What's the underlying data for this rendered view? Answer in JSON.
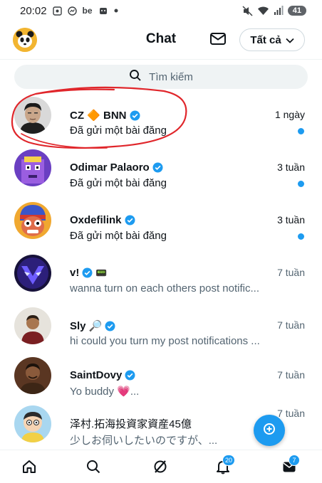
{
  "status_bar": {
    "time": "20:02",
    "icons": [
      "screenshot-icon",
      "messenger-icon",
      "be-app-icon",
      "app-icon",
      "dot-icon"
    ],
    "be_label": "be",
    "right_icons": [
      "mute-icon",
      "wifi-icon",
      "signal-icon"
    ],
    "battery": "41"
  },
  "header": {
    "title": "Chat",
    "filter_label": "Tất cả"
  },
  "search": {
    "placeholder": "Tìm kiếm"
  },
  "chats": [
    {
      "name": "CZ 🔶 BNN",
      "verified": true,
      "time": "1 ngày",
      "message": "Đã gửi một bài đăng",
      "unread": true,
      "avatar": "cz-avatar"
    },
    {
      "name": "Odimar Palaoro",
      "verified": true,
      "time": "3 tuần",
      "message": "Đã gửi một bài đăng",
      "unread": true,
      "avatar": "odimar-avatar"
    },
    {
      "name": "Oxdefilink",
      "verified": true,
      "time": "3 tuần",
      "message": "Đã gửi một bài đăng",
      "unread": true,
      "avatar": "oxdefilink-avatar"
    },
    {
      "name": "v!",
      "verified": true,
      "extra_badge": "📟",
      "time": "7 tuần",
      "message": "wanna turn on each others post notific...",
      "unread": false,
      "avatar": "v-avatar"
    },
    {
      "name": "Sly 🔎",
      "verified": true,
      "time": "7 tuần",
      "message": "hi could you turn my post notifications ...",
      "unread": false,
      "avatar": "sly-avatar"
    },
    {
      "name": "SaintDovy",
      "verified": true,
      "time": "7 tuần",
      "message": "Yo buddy 💗...",
      "unread": false,
      "avatar": "saintdovy-avatar"
    },
    {
      "name": "泽村.拓海投資家資産45億",
      "verified": false,
      "time": "7 tuần",
      "message": "少しお伺いしたいのですが、...",
      "unread": false,
      "avatar": "zecun-avatar"
    }
  ],
  "bottom_nav": {
    "items": [
      "home-icon",
      "search-icon",
      "grok-icon",
      "notifications-icon",
      "messages-icon"
    ],
    "notifications_badge": "20",
    "messages_badge": "7"
  },
  "colors": {
    "accent": "#1d9bf0",
    "annotation": "#e0262b"
  }
}
